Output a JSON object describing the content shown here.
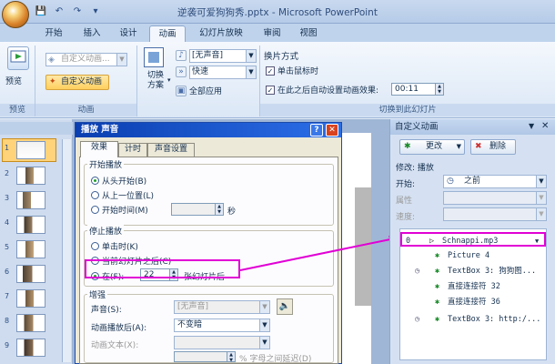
{
  "window": {
    "title": "逆袭可爱狗狗秀.pptx - Microsoft PowerPoint"
  },
  "qat": {
    "save": "💾",
    "undo": "↶",
    "redo": "↷",
    "customize": "▾"
  },
  "tabs": [
    "开始",
    "插入",
    "设计",
    "动画",
    "幻灯片放映",
    "审阅",
    "视图"
  ],
  "active_tab": "动画",
  "ribbon": {
    "preview": {
      "label": "预览",
      "group": "预览"
    },
    "animations": {
      "custom_anim_combo": "自定义动画...",
      "custom_anim_button": "自定义动画",
      "group": "动画"
    },
    "transition": {
      "scheme_label": "切换\n方案",
      "sound": "[无声音]",
      "speed": "快速",
      "apply_all": "全部应用"
    },
    "advance": {
      "title": "换片方式",
      "on_click": "单击鼠标时",
      "after": "在此之后自动设置动画效果:",
      "after_value": "00:11",
      "group": "切换到此幻灯片"
    }
  },
  "slides_panel": {
    "numbers": [
      "1",
      "2",
      "3",
      "4",
      "5",
      "6",
      "7",
      "8",
      "9"
    ]
  },
  "dialog": {
    "title": "播放 声音",
    "tabs": [
      "效果",
      "计时",
      "声音设置"
    ],
    "start_group": "开始播放",
    "start_options": [
      "从头开始(B)",
      "从上一位置(L)",
      "开始时间(M)"
    ],
    "start_unit": "秒",
    "stop_group": "停止播放",
    "stop_options": [
      "单击时(K)",
      "当前幻灯片之后(C)",
      "在(F):"
    ],
    "stop_after_value": "22",
    "stop_after_unit": "张幻灯片后",
    "enhance_group": "增强",
    "sound_label": "声音(S):",
    "sound_value": "[无声音]",
    "after_anim_label": "动画播放后(A):",
    "after_anim_value": "不变暗",
    "anim_text_label": "动画文本(X):",
    "pct_label": "% 字母之间延迟(D)"
  },
  "custom_pane": {
    "title": "自定义动画",
    "change_label": "更改",
    "delete_label": "删除",
    "modify_label": "修改: 播放",
    "start_label": "开始:",
    "start_value": "之前",
    "property_label": "属性",
    "speed_label": "速度:",
    "items": [
      {
        "num": "0",
        "icon": "▷",
        "text": "Schnappi.mp3"
      },
      {
        "num": "",
        "icon": "✱",
        "text": "Picture 4"
      },
      {
        "num": "",
        "icon": "✱",
        "text": "TextBox 3: 狗狗图..."
      },
      {
        "num": "",
        "icon": "✱",
        "text": "直接连接符 32"
      },
      {
        "num": "",
        "icon": "✱",
        "text": "直接连接符 36"
      },
      {
        "num": "",
        "icon": "✱",
        "text": "TextBox 3: http:/..."
      }
    ]
  },
  "colors": {
    "highlight": "#e100d5",
    "title_bar": "#0a3fb0"
  }
}
